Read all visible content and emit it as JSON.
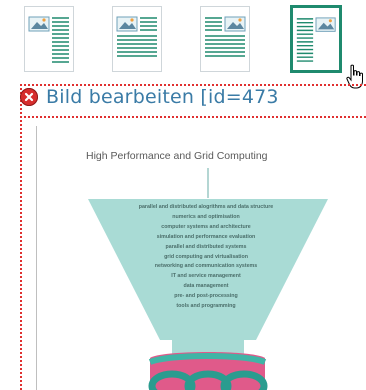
{
  "toolbar": {
    "buttons": [
      {
        "name": "image-left-text-right",
        "selected": false
      },
      {
        "name": "image-left-text-wrap",
        "selected": false
      },
      {
        "name": "image-right-text-wrap",
        "selected": false
      },
      {
        "name": "image-right-text-left",
        "selected": true
      }
    ],
    "accent_color": "#1f8a6e"
  },
  "panel": {
    "header": "Bild bearbeiten [id=473",
    "close_icon": "close-icon"
  },
  "diagram": {
    "title": "High Performance and Grid Computing",
    "items": [
      "parallel and distributed alogrithms and data structure",
      "numerics and optimisation",
      "computer systems and architecture",
      "simulation and performance evaluation",
      "parallel and distributed systems",
      "grid computing and virtualisation",
      "networking and communication systems",
      "IT and service management",
      "data management",
      "pre- and post-processing",
      "tools and programming"
    ]
  }
}
